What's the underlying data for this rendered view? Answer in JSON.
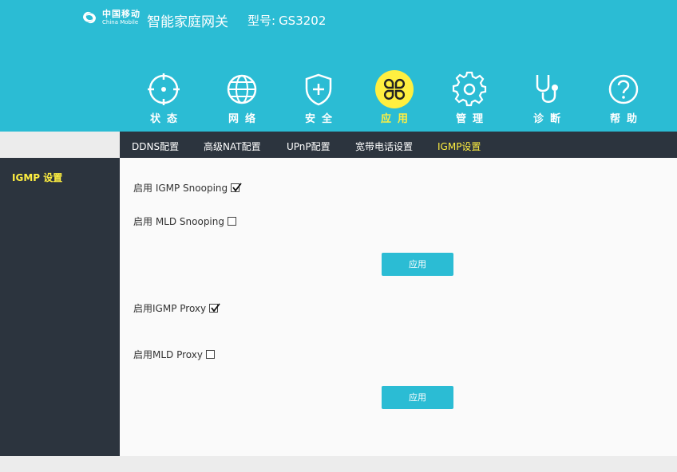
{
  "header": {
    "brand_cn": "中国移动",
    "brand_en": "China Mobile",
    "app_title": "智能家庭网关",
    "model_label": "型号:",
    "model_value": "GS3202",
    "bg_color": "#2bbcd4"
  },
  "nav": {
    "items": [
      {
        "label": "状态",
        "icon": "crosshair-icon",
        "active": false
      },
      {
        "label": "网络",
        "icon": "globe-icon",
        "active": false
      },
      {
        "label": "安全",
        "icon": "shield-icon",
        "active": false
      },
      {
        "label": "应用",
        "icon": "clover-icon",
        "active": true
      },
      {
        "label": "管理",
        "icon": "gear-icon",
        "active": false
      },
      {
        "label": "诊断",
        "icon": "stethoscope-icon",
        "active": false
      },
      {
        "label": "帮助",
        "icon": "question-icon",
        "active": false
      }
    ],
    "active_color": "#ffef40"
  },
  "subnav": {
    "items": [
      {
        "label": "DDNS配置",
        "active": false
      },
      {
        "label": "高级NAT配置",
        "active": false
      },
      {
        "label": "UPnP配置",
        "active": false
      },
      {
        "label": "宽带电话设置",
        "active": false
      },
      {
        "label": "IGMP设置",
        "active": true
      }
    ]
  },
  "sidebar": {
    "items": [
      {
        "label": "IGMP 设置",
        "active": true
      }
    ]
  },
  "content": {
    "igmp_snooping": {
      "label": "启用 IGMP Snooping",
      "checked": true
    },
    "mld_snooping": {
      "label": "启用 MLD Snooping",
      "checked": false
    },
    "apply_label_1": "应用",
    "igmp_proxy": {
      "label": "启用IGMP Proxy",
      "checked": true
    },
    "mld_proxy": {
      "label": "启用MLD Proxy",
      "checked": false
    },
    "apply_label_2": "应用"
  }
}
